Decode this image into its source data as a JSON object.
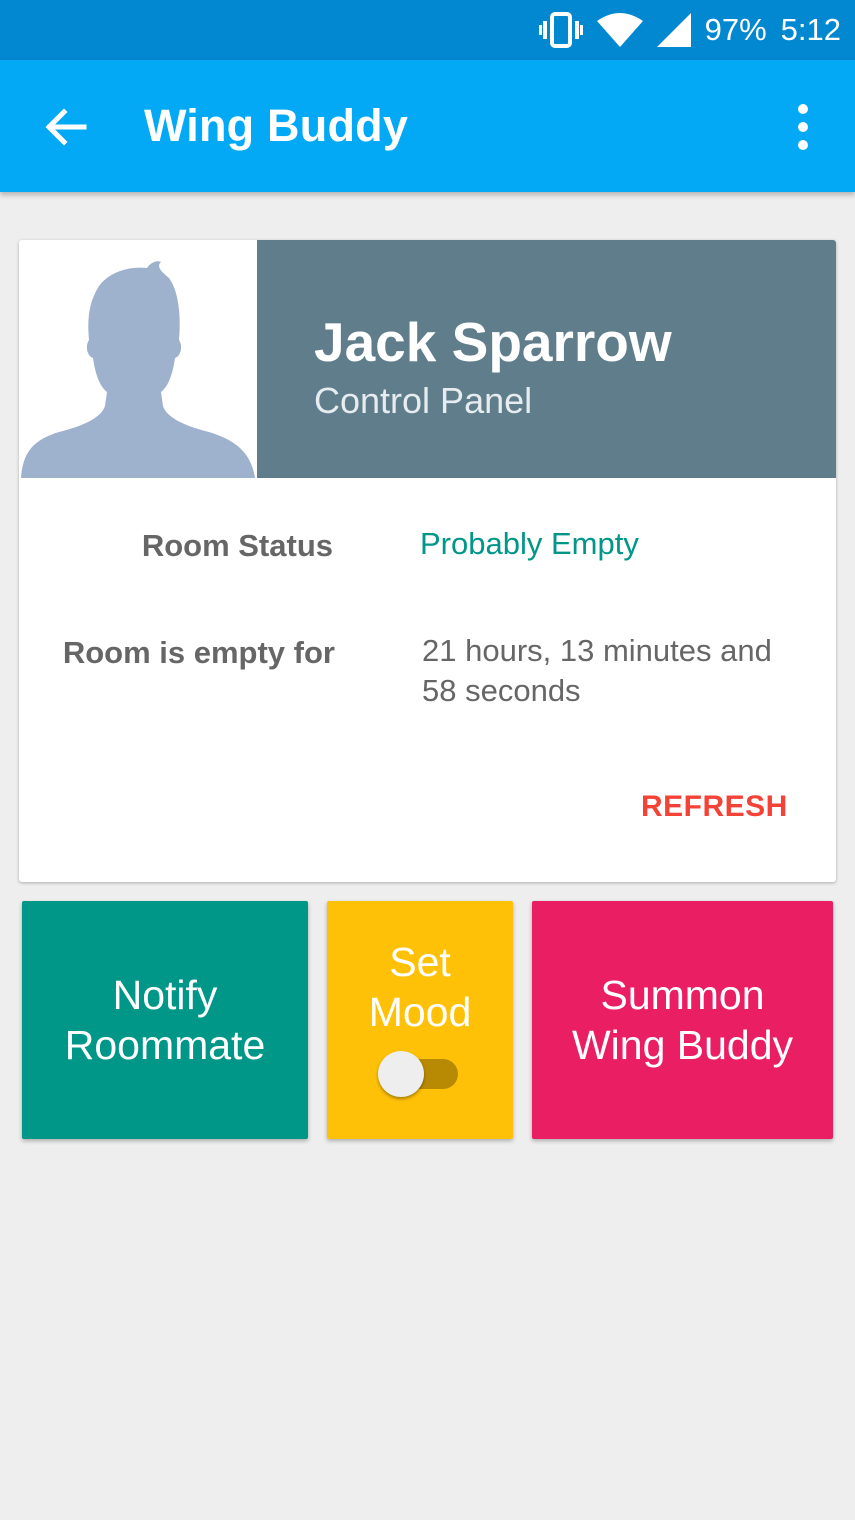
{
  "status_bar": {
    "battery": "97%",
    "time": "5:12",
    "icons": [
      "vibrate-icon",
      "wifi-icon",
      "signal-icon"
    ]
  },
  "app_bar": {
    "title": "Wing Buddy",
    "icons": [
      "back-arrow-icon",
      "overflow-menu-icon"
    ]
  },
  "profile": {
    "name": "Jack Sparrow",
    "subtitle": "Control Panel"
  },
  "status_rows": {
    "room_status_label": "Room Status",
    "room_status_value": "Probably Empty",
    "empty_for_label": "Room is empty for",
    "empty_for_value": "21 hours, 13 minutes and 58 seconds"
  },
  "refresh_label": "REFRESH",
  "actions": {
    "notify_line1": "Notify",
    "notify_line2": "Roommate",
    "mood_line1": "Set",
    "mood_line2": "Mood",
    "mood_toggle_on": false,
    "summon_line1": "Summon",
    "summon_line2": "Wing Buddy"
  },
  "colors": {
    "status_bar": "#0288d1",
    "app_bar": "#03a9f4",
    "header": "#607d8b",
    "teal": "#009688",
    "amber": "#ffc107",
    "pink": "#e91e63",
    "refresh": "#f44336"
  }
}
